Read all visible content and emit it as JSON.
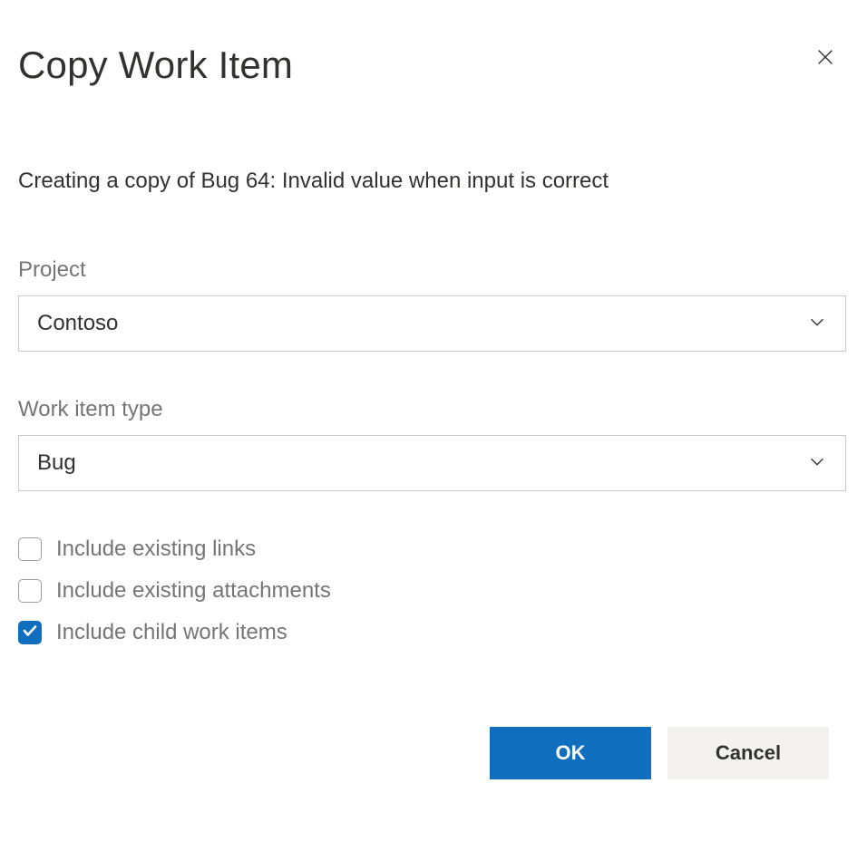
{
  "dialog": {
    "title": "Copy Work Item",
    "description": "Creating a copy of Bug 64: Invalid value when input is correct"
  },
  "fields": {
    "project": {
      "label": "Project",
      "value": "Contoso"
    },
    "workItemType": {
      "label": "Work item type",
      "value": "Bug"
    }
  },
  "checkboxes": {
    "includeLinks": {
      "label": "Include existing links",
      "checked": false
    },
    "includeAttachments": {
      "label": "Include existing attachments",
      "checked": false
    },
    "includeChildItems": {
      "label": "Include child work items",
      "checked": true
    }
  },
  "buttons": {
    "ok": "OK",
    "cancel": "Cancel"
  }
}
